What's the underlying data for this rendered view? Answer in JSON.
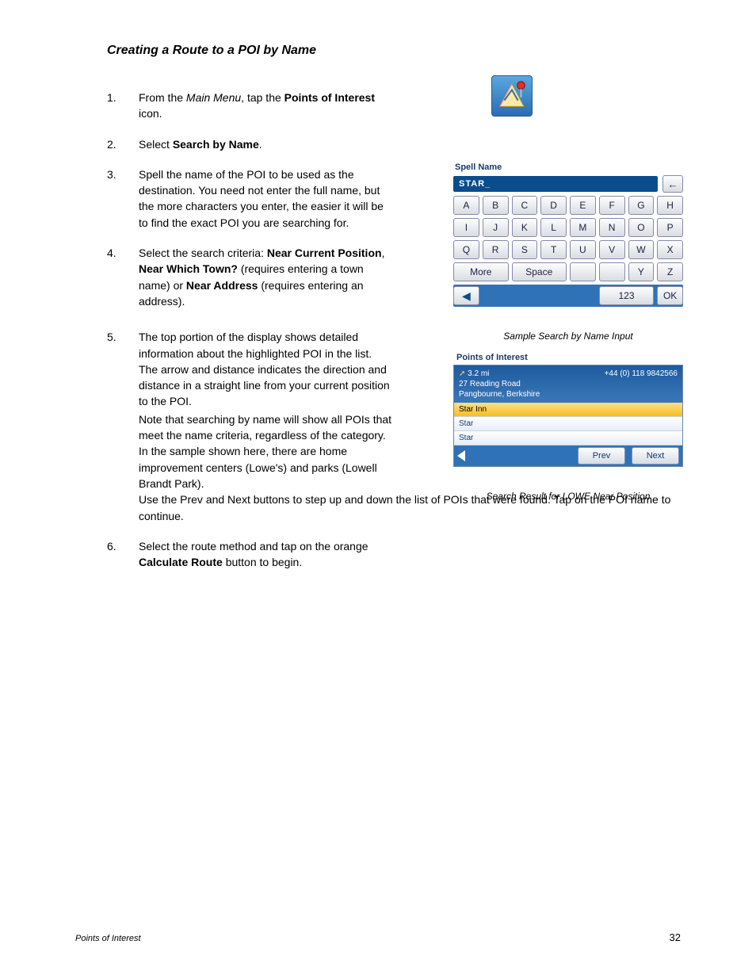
{
  "title": "Creating a Route to a POI by Name",
  "steps": {
    "s1": {
      "pre": "From the ",
      "em": "Main Menu",
      "mid": ", tap the ",
      "b": "Points of Interest",
      "post": " icon."
    },
    "s2": {
      "pre": "Select ",
      "b": "Search by Name",
      "post": "."
    },
    "s3": "Spell the name of the POI to be used as the destination. You need not enter the full name, but the more characters you enter, the easier it will be to find the exact POI you are searching for.",
    "s4": {
      "pre": "Select the search criteria: ",
      "b1": "Near Current Position",
      "mid1": ", ",
      "b2": "Near Which Town?",
      "mid2": " (requires entering a town name) or ",
      "b3": "Near Address",
      "post": " (requires entering an address)."
    },
    "s5a": "The top portion of the display shows detailed information about the highlighted POI in the list. The arrow and distance indicates the direction and distance in a straight line from your current position to the POI.",
    "s5b": "Note that searching by name will show all POIs that meet the name criteria, regardless of the category. In the sample shown here, there are home improvement centers (Lowe's) and parks (Lowell Brandt Park).",
    "s5c": "Use the Prev and Next buttons to step up and down the list of POIs that were found. Tap on the POI name to continue.",
    "s6": {
      "pre": "Select the route method and tap on the orange ",
      "b": "Calculate Route",
      "post": " button to begin."
    }
  },
  "keypad": {
    "header": "Spell Name",
    "input": "STAR_",
    "keys": [
      "A",
      "B",
      "C",
      "D",
      "E",
      "F",
      "G",
      "H",
      "I",
      "J",
      "K",
      "L",
      "M",
      "N",
      "O",
      "P",
      "Q",
      "R",
      "S",
      "T",
      "U",
      "V",
      "W",
      "X"
    ],
    "more": "More",
    "space": "Space",
    "y": "Y",
    "z": "Z",
    "num": "123",
    "ok": "OK",
    "caption": "Sample Search by Name Input"
  },
  "results": {
    "header": "Points of Interest",
    "distance": "3.2 mi",
    "phone": "+44 (0) 118 9842566",
    "addr1": "27 Reading Road",
    "addr2": "Pangbourne, Berkshire",
    "items": [
      "Star Inn",
      "Star",
      "Star"
    ],
    "prev": "Prev",
    "next": "Next",
    "caption": "Search Result for LOWE Near Position"
  },
  "footer": {
    "section": "Points of Interest",
    "page": "32"
  }
}
